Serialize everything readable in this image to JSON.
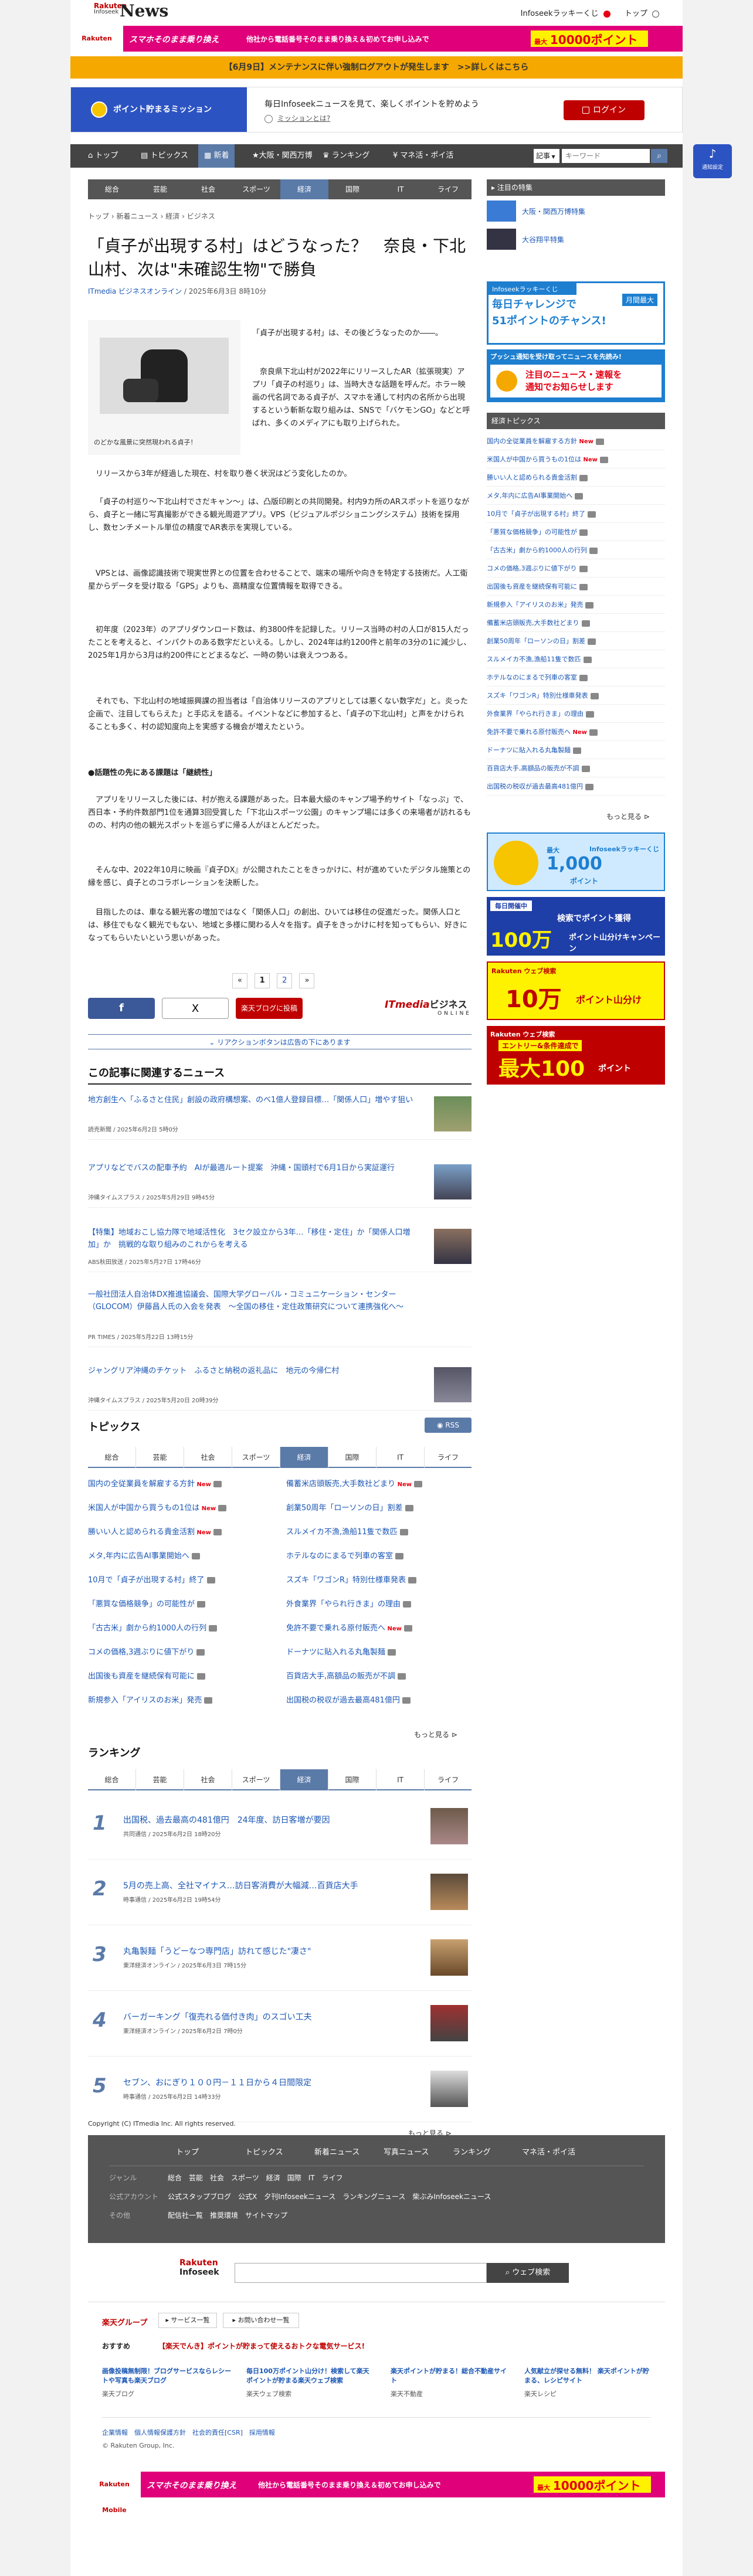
{
  "header": {
    "logo_rakuten": "Rakuten",
    "logo_infoseek": "Infoseek",
    "logo_news": "News",
    "lucky": "Infoseekラッキーくじ",
    "top": "トップ"
  },
  "banner_top": {
    "brand": "Rakuten Mobile",
    "text": "スマホそのまま乗り換え",
    "text2": "他社から電話番号そのまま乗り換え＆初めてお申し込みで",
    "badge": "最大",
    "points": "10000ポイント"
  },
  "notice": {
    "text": "【6月9日】メンテナンスに伴い強制ログアウトが発生します　>>詳しくはこちら"
  },
  "mission": {
    "btn": "ポイント貯まるミッション",
    "line1": "毎日Infoseekニュースを見て、楽しくポイントを貯めよう",
    "help": "ミッションとは?",
    "login": "ログイン"
  },
  "nav_main": [
    {
      "label": "トップ",
      "icon": "home-icon"
    },
    {
      "label": "トピックス",
      "icon": "topics-icon"
    },
    {
      "label": "新着",
      "icon": "new-icon"
    },
    {
      "label": "大阪・関西万博",
      "icon": "star-icon"
    },
    {
      "label": "ランキング",
      "icon": "crown-icon"
    },
    {
      "label": "マネ活・ポイ活",
      "icon": "money-icon"
    }
  ],
  "search": {
    "select": "記事",
    "placeholder": "キーワード"
  },
  "float_btn": {
    "label": "通知設定"
  },
  "nav_sub": [
    "総合",
    "芸能",
    "社会",
    "スポーツ",
    "経済",
    "国際",
    "IT",
    "ライフ"
  ],
  "breadcrumb": [
    "トップ",
    "新着ニュース",
    "経済",
    "ビジネス"
  ],
  "article": {
    "title": "「貞子が出現する村」はどうなった？　奈良・下北山村、次は\"未確認生物\"で勝負",
    "source": "ITmedia ビジネスオンライン",
    "date": "/ 2025年6月3日 8時10分",
    "image_caption": "のどかな風景に突然現われる貞子！",
    "lead": "「貞子が出現する村」は、その後どうなったのか――。",
    "p1": "奈良県下北山村が2022年にリリースしたAR（拡張現実）アプリ「貞子の村巡り」は、当時大きな話題を呼んだ。ホラー映画の代名詞である貞子が、スマホを通して村内の名所から出現するという斬新な取り組みは、SNSで「バケモンGO」などと呼ばれ、多くのメディアにも取り上げられた。",
    "p2": "リリースから3年が経過した現在、村を取り巻く状況はどう変化したのか。",
    "p3": "「貞子の村巡り～下北山村でさだキャン～」は、凸版印刷との共同開発。村内9カ所のARスポットを巡りながら、貞子と一緒に写真撮影ができる観光周遊アプリ。VPS（ビジュアルポジショニングシステム）技術を採用し、数センチメートル単位の精度でAR表示を実現している。",
    "p4": "VPSとは、画像認識技術で現実世界との位置を合わせることで、端末の場所や向きを特定する技術だ。人工衛星からデータを受け取る「GPS」よりも、高精度な位置情報を取得できる。",
    "p5": "初年度（2023年）のアプリダウンロード数は、約3800件を記録した。リリース当時の村の人口が815人だったことを考えると、インパクトのある数字だといえる。しかし、2024年は約1200件と前年の3分の1に減少し、2025年1月から3月は約200件にとどまるなど、一時の勢いは衰えつつある。",
    "p6": "それでも、下北山村の地域振興課の担当者は「自治体リリースのアプリとしては悪くない数字だ」と。炎った企画で、注目してもらえた」と手応えを語る。イベントなどに参加すると、「貞子の下北山村」と声をかけられることも多く、村の認知度向上を実感する機会が増えたという。",
    "h2": "●話題性の先にある課題は「継続性」",
    "p7": "アプリをリリースした後には、村が抱える課題があった。日本最大級のキャンプ場予約サイト「なっぷ」で、西日本・予約件数部門1位を通算3回受賞した「下北山スポーツ公園」のキャンプ場には多くの来場者が訪れるものの、村内の他の観光スポットを巡らずに帰る人がほとんどだった。",
    "p8": "そんな中、2022年10月に映画『貞子DX』が公開されたことをきっかけに、村が進めていたデジタル施策との縁を感じ、貞子とのコラボレーションを決断した。",
    "p9": "目指したのは、車なる観光客の増加ではなく「関係人口」の創出、ひいては移住の促進だった。関係人口とは、移住でもなく観光でもない、地域と多様に関わる人々を指す。貞子をきっかけに村を知ってもらい、好きになってもらいたいという思いがあった。"
  },
  "pager": {
    "prev": "«",
    "p1": "1",
    "p2": "2",
    "next": "»"
  },
  "share": {
    "facebook": "f",
    "x": "X",
    "lineup": "楽天ブログに投稿",
    "itm1": "ITmedia",
    "itm2": "ビジネス",
    "itm3": "ONLINE"
  },
  "ad_notice": "リアクションボタンは広告の下にあります",
  "related": {
    "heading": "この記事に関連するニュース",
    "items": [
      {
        "title": "地方創生へ「ふるさと住民」創設の政府構想案、のべ1億人登録目標…「関係人口」増やす狙い",
        "meta": "読売新聞 / 2025年6月2日 5時0分"
      },
      {
        "title": "アプリなどでバスの配車予約　AIが最適ルート提案　沖縄・国頭村で6月1日から実証運行",
        "meta": "沖縄タイムスプラス / 2025年5月29日 9時45分"
      },
      {
        "title": "【特集】地域おこし協力隊で地域活性化　3セク設立から3年…「移住・定住」か「関係人口増加」か　挑戦的な取り組みのこれからを考える",
        "meta": "ABS秋田放送 / 2025年5月27日 17時46分"
      },
      {
        "title": "一般社団法人自治体DX推進協議会、国際大学グローバル・コミュニケーション・センター（GLOCOM）伊藤昌人氏の入会を発表　～全国の移住・定住政策研究について連携強化へ～",
        "meta": "PR TIMES / 2025年5月22日 13時15分"
      },
      {
        "title": "ジャングリア沖縄のチケット　ふるさと納税の返礼品に　地元の今帰仁村",
        "meta": "沖縄タイムスプラス / 2025年5月20日 20時39分"
      }
    ]
  },
  "topics": {
    "heading": "トピックス",
    "rss": "RSS",
    "tabs": [
      "総合",
      "芸能",
      "社会",
      "スポーツ",
      "経済",
      "国際",
      "IT",
      "ライフ"
    ],
    "left": [
      "国内の全従業員を解雇する方針",
      "米国人が中国から買うもの1位は",
      "勝いい人と認められる貴金活割",
      "メタ,年内に広告AI事業開始へ",
      "10月で「貞子が出現する村」終了",
      "「悪質な価格競争」の可能性が",
      "「古古米」劇から約1000人の行列",
      "コメの価格,3週ぶりに値下がり",
      "出国後も資産を継続保有可能に",
      "新規参入「アイリスのお米」発売"
    ],
    "right": [
      "備蓄米店頭販売,大手数社どまり",
      "創業50周年「ローソンの日」割差",
      "スルメイカ不漁,漁船11隻で数匹",
      "ホテルなのにまるで列車の客室",
      "スズキ「ワゴンR」特別仕様車発表",
      "外食業界「やられ行きま」の理由",
      "免許不要で乗れる原付販売へ",
      "ドーナツに貼入れる丸亀製麺",
      "百貨店大手,高額品の販売が不調",
      "出国税の税収が過去最高481億円"
    ],
    "new_left": [
      1,
      1,
      1,
      0,
      0,
      0,
      0,
      0,
      0,
      0
    ],
    "new_right": [
      1,
      0,
      0,
      0,
      0,
      0,
      1,
      0,
      0,
      0
    ],
    "more": "もっと見る"
  },
  "ranking": {
    "heading": "ランキング",
    "tabs": [
      "総合",
      "芸能",
      "社会",
      "スポーツ",
      "経済",
      "国際",
      "IT",
      "ライフ"
    ],
    "items": [
      {
        "n": "1",
        "title": "出国税、過去最高の481億円　24年度、訪日客増が要因",
        "meta": "共同通信 / 2025年6月2日 18時20分"
      },
      {
        "n": "2",
        "title": "5月の売上高、全社マイナス…訪日客消費が大幅減…百貨店大手",
        "meta": "時事通信 / 2025年6月2日 19時54分"
      },
      {
        "n": "3",
        "title": "丸亀製麺「うどーなつ専門店」訪れて感じた\"凄さ\"",
        "meta": "東洋経済オンライン / 2025年6月3日 7時15分"
      },
      {
        "n": "4",
        "title": "バーガーキング「復売れる価付き肉」のスゴい工夫",
        "meta": "東洋経済オンライン / 2025年6月2日 7時0分"
      },
      {
        "n": "5",
        "title": "セブン、おにぎり１００円－１１日から４日間限定",
        "meta": "時事通信 / 2025年6月2日 14時33分"
      }
    ],
    "more": "もっと見る"
  },
  "copyright": "Copyright (C) ITmedia Inc. All rights reserved.",
  "sidebar": {
    "ad1": "大阪・関西万博特集",
    "ad2": "大谷翔平特集",
    "ad_heading": "注目の特集",
    "promo1a": "Infoseekラッキーくじ",
    "promo1b": "毎日チャレンジで",
    "promo1c": "月間最大",
    "promo1d": "51ポイントのチャンス!",
    "promo2a": "プッシュ通知を受け取ってニュースを先読み!",
    "promo2b": "注目のニュース・速報を",
    "promo2c": "通知でお知らせします",
    "econ_heading": "経済トピックス",
    "econ": [
      "国内の全従業員を解雇する方針",
      "米国人が中国から買うもの1位は",
      "勝いい人と認められる貴金活割",
      "メタ,年内に広告AI事業開始へ",
      "10月で「貞子が出現する村」終了",
      "「悪質な価格競争」の可能性が",
      "「古古米」劇から約1000人の行列",
      "コメの価格,3週ぶりに値下がり",
      "出国後も資産を継続保有可能に",
      "新規参入「アイリスのお米」発売",
      "備蓄米店頭販売,大手数社どまり",
      "創業50周年「ローソンの日」割差",
      "スルメイカ不漁,漁船11隻で数匹",
      "ホテルなのにまるで列車の客室",
      "スズキ「ワゴンR」特別仕様車発表",
      "外食業界「やられ行きま」の理由",
      "免許不要で乗れる原付販売へ",
      "ドーナツに貼入れる丸亀製麺",
      "百貨店大手,高額品の販売が不調",
      "出国税の税収が過去最高481億円"
    ],
    "econ_new": [
      1,
      1,
      0,
      0,
      0,
      0,
      0,
      0,
      0,
      0,
      0,
      0,
      0,
      0,
      0,
      0,
      1,
      0,
      0,
      0
    ],
    "more": "もっと見る",
    "b1a": "Infoseekラッキーくじ",
    "b1b": "最大",
    "b1c": "1,000",
    "b1d": "ポイント",
    "b2a": "毎日開催中",
    "b2b": "検索でポイント獲得",
    "b2c": "100万",
    "b2d": "ポイント山分けキャンペーン",
    "b3a": "Rakuten ウェブ検索",
    "b3b": "10万",
    "b3c": "ポイント山分け",
    "b4a": "Rakuten ウェブ検索",
    "b4b": "エントリー&条件達成で",
    "b4c": "最大100",
    "b4d": "ポイント"
  },
  "footer": {
    "nav": [
      "トップ",
      "トピックス",
      "新着ニュース",
      "写真ニュース",
      "ランキング",
      "マネ活・ポイ活"
    ],
    "genre_label": "ジャンル",
    "genre": "総合　芸能　社会　スポーツ　経済　国際　IT　ライフ",
    "official_label": "公式アカウント",
    "official": "公式スタップブログ　公式X　夕刊Infoseekニュース　ランキングニュース　柴ぶみInfoseekニュース",
    "other_label": "その他",
    "other": "配信社一覧　推奨環境　サイトマップ",
    "search_btn": "ウェブ検索",
    "group_heading": "楽天グループ",
    "services": "サービス一覧",
    "contact": "お問い合わせ一覧",
    "recommend": "おすすめ",
    "rec_title": "【楽天でんき】ポイントが貯まって使えるおトクな電気サービス!",
    "rec1": "画像投稿無制限！ブログサービスならレシートや写真も楽天ブログ",
    "rec1s": "楽天ブログ",
    "rec2": "毎日100万ポイント山分け！検索して楽天ポイントが貯まる楽天ウェブ検索",
    "rec2s": "楽天ウェブ検索",
    "rec3": "楽天ポイントが貯まる！総合不動産サイト",
    "rec3s": "楽天不動産",
    "rec4": "人気献立が探せる無料！ 楽天ポイントが貯まる、レシピサイト",
    "rec4s": "楽天レシピ",
    "links": "企業情報　個人情報保護方針　社会的責任[CSR]　採用情報",
    "copy": "© Rakuten Group, Inc."
  },
  "colors": {
    "rakuten": "#bf0000",
    "accent_blue": "#5a7aa8",
    "nav_dark": "#444444",
    "notice": "#f5a800",
    "magenta": "#e0007a"
  }
}
